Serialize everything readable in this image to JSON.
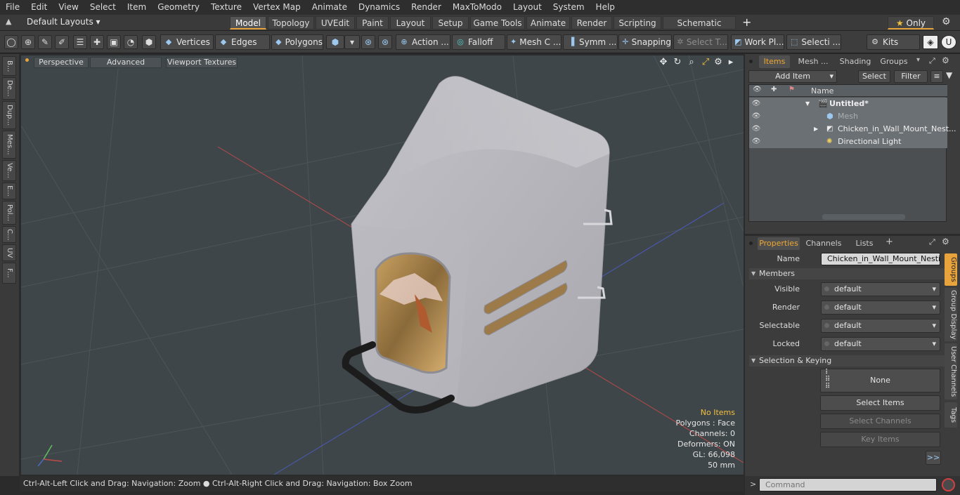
{
  "menu": [
    "File",
    "Edit",
    "View",
    "Select",
    "Item",
    "Geometry",
    "Texture",
    "Vertex Map",
    "Animate",
    "Dynamics",
    "Render",
    "MaxToModo",
    "Layout",
    "System",
    "Help"
  ],
  "layout_selector": "Default Layouts ▾",
  "mode_tabs": [
    "Model",
    "Topology",
    "UVEdit",
    "Paint",
    "Layout",
    "Setup",
    "Game Tools",
    "Animate",
    "Render",
    "Scripting",
    "Schematic Fusion"
  ],
  "only_label": "Only",
  "toolbar": {
    "vertices": "Vertices",
    "edges": "Edges",
    "polygons": "Polygons",
    "action": "Action ...",
    "falloff": "Falloff",
    "mesh_c": "Mesh C ...",
    "symm": "Symm ...",
    "snapping": "Snapping",
    "select_t": "Select T...",
    "work_pl": "Work Pl...",
    "selecti": "Selecti ...",
    "kits": "Kits"
  },
  "left_tabs": [
    "B...",
    "De...",
    "Dup...",
    "Mes...",
    "Ve...",
    "E...",
    "Pol...",
    "C...",
    "UV",
    "F..."
  ],
  "viewport": {
    "perspective": "Perspective",
    "advanced": "Advanced",
    "viewport_textures": "Viewport Textures",
    "info": {
      "no_items": "No Items",
      "polygons": "Polygons : Face",
      "channels": "Channels: 0",
      "deformers": "Deformers: ON",
      "gl": "GL: 66,098",
      "distance": "50 mm"
    }
  },
  "status_bar": "Ctrl-Alt-Left Click and Drag: Navigation: Zoom ● Ctrl-Alt-Right Click and Drag: Navigation: Box Zoom",
  "items_panel": {
    "tabs": [
      "Items",
      "Mesh ...",
      "Shading",
      "Groups"
    ],
    "add_item": "Add Item",
    "select": "Select",
    "filter": "Filter",
    "column_name": "Name",
    "tree": [
      {
        "label": "Untitled*"
      },
      {
        "label": "Mesh"
      },
      {
        "label": "Chicken_in_Wall_Mount_Nest..."
      },
      {
        "label": "Directional Light"
      }
    ]
  },
  "properties_panel": {
    "tabs": [
      "Properties",
      "Channels",
      "Lists"
    ],
    "name_label": "Name",
    "name_value": "Chicken_in_Wall_Mount_Nesting_",
    "members": "Members",
    "rows": [
      {
        "label": "Visible",
        "value": "default"
      },
      {
        "label": "Render",
        "value": "default"
      },
      {
        "label": "Selectable",
        "value": "default"
      },
      {
        "label": "Locked",
        "value": "default"
      }
    ],
    "selection_keying": "Selection & Keying",
    "none": "None",
    "select_items": "Select Items",
    "select_channels": "Select Channels",
    "key_items": "Key Items",
    "more": ">>",
    "side_tabs": [
      "Groups",
      "Group Display",
      "User Channels",
      "Tags"
    ]
  },
  "command_placeholder": "Command"
}
